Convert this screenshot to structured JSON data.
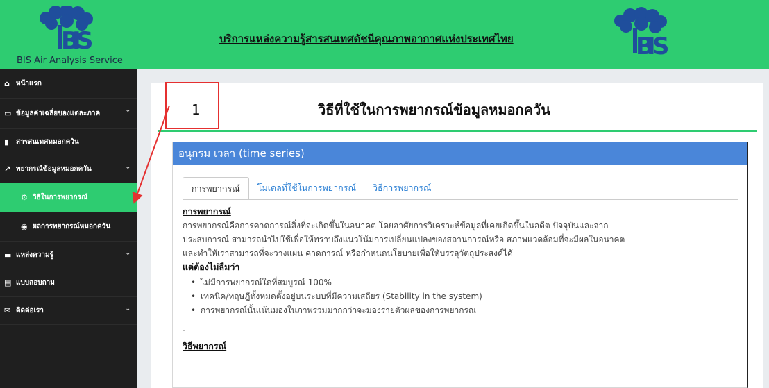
{
  "header": {
    "brand_text": "BIS Air Analysis Service",
    "title": "บริการแหล่งความรู้สารสนเทศดัชนีคุณภาพอากาศแห่งประเทศไทย",
    "logo_text": "BIS"
  },
  "sidebar": {
    "items": [
      {
        "label": "หน้าแรก",
        "icon": "home-icon"
      },
      {
        "label": "ข้อมูลค่าเฉลี่ยของแต่ละภาค",
        "icon": "monitor-icon"
      },
      {
        "label": "สารสนเทศหมอกควัน",
        "icon": "bar-chart-icon"
      },
      {
        "label": "พยากรณ์ข้อมูลหมอกควัน",
        "icon": "line-chart-icon"
      },
      {
        "label": "วิธีในการพยากรณ์",
        "icon": "gears-icon"
      },
      {
        "label": "ผลการพยากรณ์หมอกควัน",
        "icon": "eye-icon"
      },
      {
        "label": "แหล่งความรู้",
        "icon": "book-icon"
      },
      {
        "label": "แบบสอบถาม",
        "icon": "form-icon"
      },
      {
        "label": "ติดต่อเรา",
        "icon": "comment-icon"
      }
    ]
  },
  "main": {
    "page_title": "วิธีที่ใช้ในการพยากรณ์ข้อมูลหมอกควัน",
    "panel_title": "อนุกรม เวลา (time series)",
    "tabs": [
      "การพยากรณ์",
      "โมเดลที่ใช้ในการพยากรณ์",
      "วิธีการพยากรณ์"
    ],
    "content": {
      "heading1": "การพยากรณ์",
      "para1_line1": "การพยากรณ์คือการคาดการณ์สิ่งที่จะเกิดขึ้นในอนาคต    โดยอาศัยการวิเคราะห์ข้อมูลที่เคยเกิดขึ้นในอดีต    ปัจจุบันและจาก",
      "para1_line2": "ประสบการณ์  สามารถนำไปใช้เพื่อให้ทราบถึงแนวโน้มการเปลี่ยนแปลงของสถานการณ์หรือ  สภาพแวดล้อมที่จะมีผลในอนาคต",
      "para1_line3": "และทำให้เราสามารถที่จะวางแผน คาดการณ์ หรือกำหนดนโยบายเพื่อให้บรรลุวัตถุประสงค์ได้",
      "heading2": "แต่ต้องไม่ลืมว่า",
      "bullets": [
        "ไม่มีการพยากรณ์ใดที่สมบูรณ์ 100%",
        "เทคนิค/ทฤษฎีทั้งหมดตั้งอยู่บนระบบที่มีความเสถียร (Stability in the system)",
        "การพยากรณ์นั้นเน้นมองในภาพรวมมากกว่าจะมองรายตัวผลของการพยากรณ"
      ],
      "dash": "-",
      "heading3": "วิธีพยากรณ์"
    }
  },
  "annotation": {
    "number": "1"
  },
  "colors": {
    "header_green": "#2ecc71",
    "sidebar_bg": "#1f1f1f",
    "panel_blue": "#4a86d9",
    "annotation_red": "#e53030"
  }
}
